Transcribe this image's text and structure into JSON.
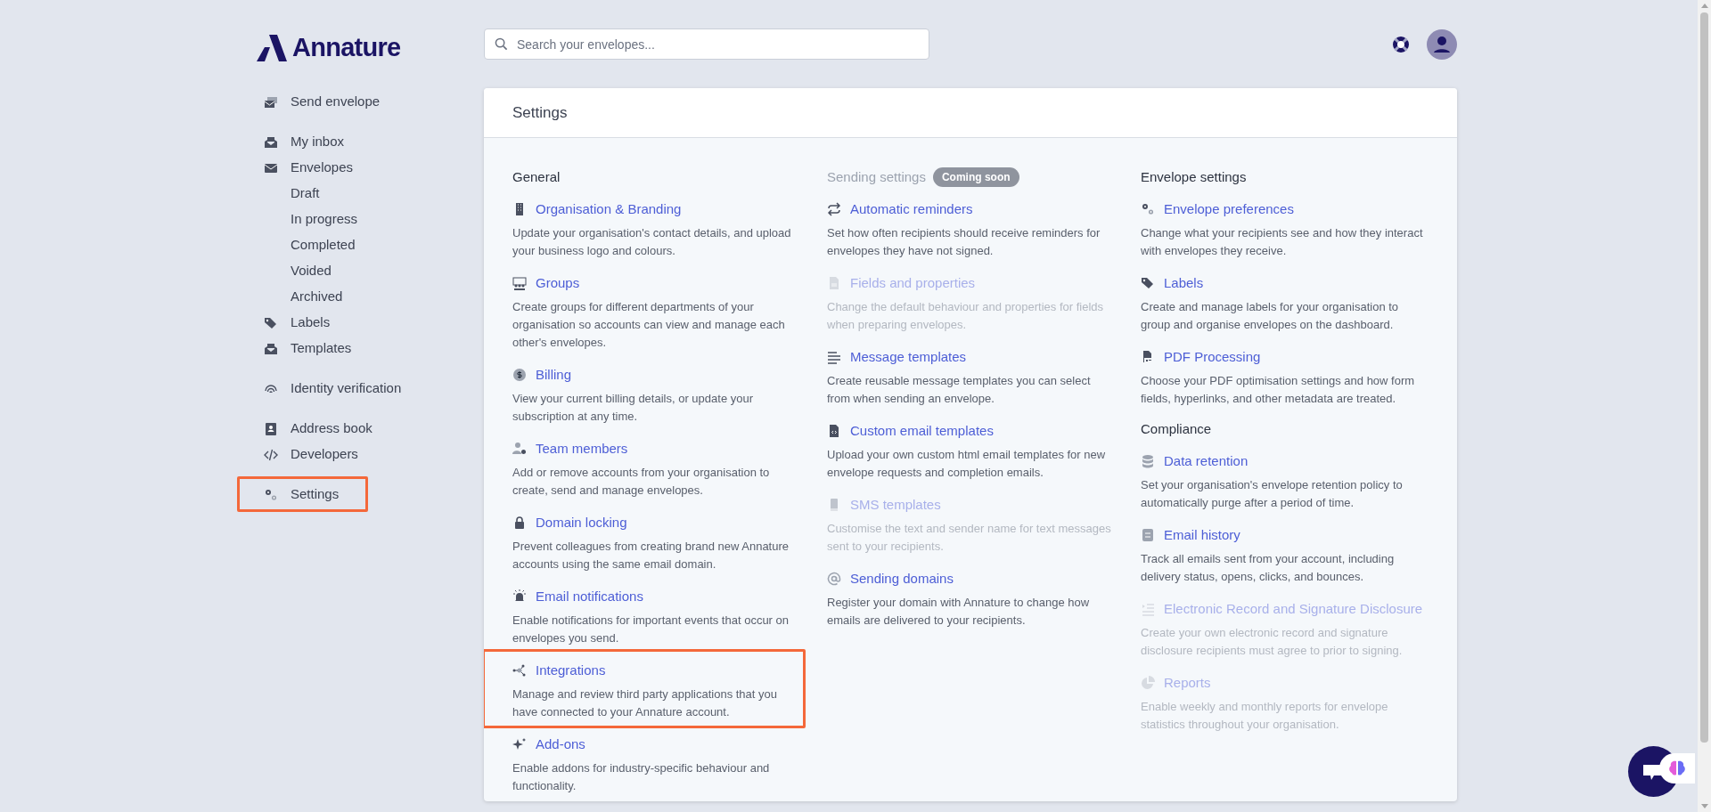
{
  "brand": {
    "name": "Annature"
  },
  "sidebar": {
    "groups": [
      [
        {
          "label": "Send envelope",
          "highlighted": false
        }
      ],
      [
        {
          "label": "My inbox",
          "highlighted": false
        },
        {
          "label": "Envelopes",
          "highlighted": false,
          "children": [
            {
              "label": "Draft"
            },
            {
              "label": "In progress"
            },
            {
              "label": "Completed"
            },
            {
              "label": "Voided"
            },
            {
              "label": "Archived"
            }
          ]
        },
        {
          "label": "Labels",
          "highlighted": false
        },
        {
          "label": "Templates",
          "highlighted": false
        }
      ],
      [
        {
          "label": "Identity verification",
          "highlighted": false
        }
      ],
      [
        {
          "label": "Address book",
          "highlighted": false
        },
        {
          "label": "Developers",
          "highlighted": false
        }
      ],
      [
        {
          "label": "Settings",
          "highlighted": true
        }
      ]
    ]
  },
  "search": {
    "placeholder": "Search your envelopes..."
  },
  "panel": {
    "title": "Settings",
    "columns": [
      {
        "sections": [
          {
            "heading": "General",
            "items": [
              {
                "title": "Organisation & Branding",
                "description": "Update your organisation's contact details, and upload your business logo and colours.",
                "disabled": false,
                "highlighted": false
              },
              {
                "title": "Groups",
                "description": "Create groups for different departments of your organisation so accounts can view and manage each other's envelopes.",
                "disabled": false,
                "highlighted": false
              },
              {
                "title": "Billing",
                "description": "View your current billing details, or update your subscription at any time.",
                "disabled": false,
                "highlighted": false
              },
              {
                "title": "Team members",
                "description": "Add or remove accounts from your organisation to create, send and manage envelopes.",
                "disabled": false,
                "highlighted": false
              },
              {
                "title": "Domain locking",
                "description": "Prevent colleagues from creating brand new Annature accounts using the same email domain.",
                "disabled": false,
                "highlighted": false
              },
              {
                "title": "Email notifications",
                "description": "Enable notifications for important events that occur on envelopes you send.",
                "disabled": false,
                "highlighted": false
              },
              {
                "title": "Integrations",
                "description": "Manage and review third party applications that you have connected to your Annature account.",
                "disabled": false,
                "highlighted": true
              },
              {
                "title": "Add-ons",
                "description": "Enable addons for industry-specific behaviour and functionality.",
                "disabled": false,
                "highlighted": false
              }
            ]
          }
        ]
      },
      {
        "sections": [
          {
            "heading": "Sending settings",
            "heading_disabled": true,
            "badge": "Coming soon",
            "items": [
              {
                "title": "Automatic reminders",
                "description": "Set how often recipients should receive reminders for envelopes they have not signed.",
                "disabled": false,
                "highlighted": false
              },
              {
                "title": "Fields and properties",
                "description": "Change the default behaviour and properties for fields when preparing envelopes.",
                "disabled": true,
                "highlighted": false
              },
              {
                "title": "Message templates",
                "description": "Create reusable message templates you can select from when sending an envelope.",
                "disabled": false,
                "highlighted": false
              },
              {
                "title": "Custom email templates",
                "description": "Upload your own custom html email templates for new envelope requests and completion emails.",
                "disabled": false,
                "highlighted": false
              },
              {
                "title": "SMS templates",
                "description": "Customise the text and sender name for text messages sent to your recipients.",
                "disabled": true,
                "highlighted": false
              },
              {
                "title": "Sending domains",
                "description": "Register your domain with Annature to change how emails are delivered to your recipients.",
                "disabled": false,
                "highlighted": false
              }
            ]
          }
        ]
      },
      {
        "sections": [
          {
            "heading": "Envelope settings",
            "items": [
              {
                "title": "Envelope preferences",
                "description": "Change what your recipients see and how they interact with envelopes they receive.",
                "disabled": false,
                "highlighted": false
              },
              {
                "title": "Labels",
                "description": "Create and manage labels for your organisation to group and organise envelopes on the dashboard.",
                "disabled": false,
                "highlighted": false
              },
              {
                "title": "PDF Processing",
                "description": "Choose your PDF optimisation settings and how form fields, hyperlinks, and other metadata are treated.",
                "disabled": false,
                "highlighted": false
              }
            ]
          },
          {
            "heading": "Compliance",
            "items": [
              {
                "title": "Data retention",
                "description": "Set your organisation's envelope retention policy to automatically purge after a period of time.",
                "disabled": false,
                "highlighted": false
              },
              {
                "title": "Email history",
                "description": "Track all emails sent from your account, including delivery status, opens, clicks, and bounces.",
                "disabled": false,
                "highlighted": false
              },
              {
                "title": "Electronic Record and Signature Disclosure",
                "description": "Create your own electronic record and signature disclosure recipients must agree to prior to signing.",
                "disabled": true,
                "highlighted": false
              },
              {
                "title": "Reports",
                "description": "Enable weekly and monthly reports for envelope statistics throughout your organisation.",
                "disabled": true,
                "highlighted": false
              }
            ]
          }
        ]
      }
    ]
  }
}
